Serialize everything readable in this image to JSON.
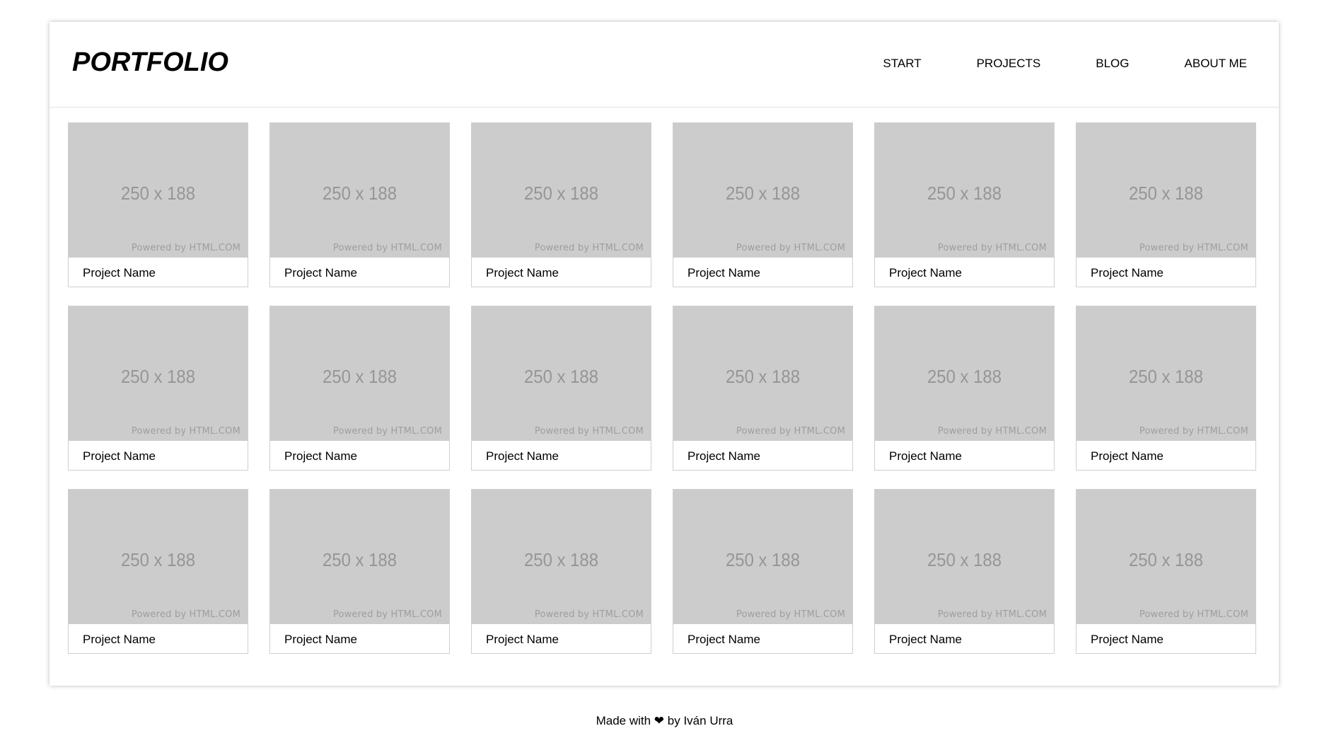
{
  "header": {
    "logo": "PORTFOLIO",
    "nav": [
      "START",
      "PROJECTS",
      "BLOG",
      "ABOUT ME"
    ]
  },
  "thumbnail": {
    "size_label": "250 x 188",
    "powered_label": "Powered by HTML.COM"
  },
  "projects": [
    {
      "name": "Project Name"
    },
    {
      "name": "Project Name"
    },
    {
      "name": "Project Name"
    },
    {
      "name": "Project Name"
    },
    {
      "name": "Project Name"
    },
    {
      "name": "Project Name"
    },
    {
      "name": "Project Name"
    },
    {
      "name": "Project Name"
    },
    {
      "name": "Project Name"
    },
    {
      "name": "Project Name"
    },
    {
      "name": "Project Name"
    },
    {
      "name": "Project Name"
    },
    {
      "name": "Project Name"
    },
    {
      "name": "Project Name"
    },
    {
      "name": "Project Name"
    },
    {
      "name": "Project Name"
    },
    {
      "name": "Project Name"
    },
    {
      "name": "Project Name"
    }
  ],
  "footer": {
    "text": "Made with ❤ by Iván Urra"
  },
  "colors": {
    "thumbnail_bg": "#cccccc",
    "thumbnail_text": "#969696",
    "card_border": "#cfcfcf"
  }
}
